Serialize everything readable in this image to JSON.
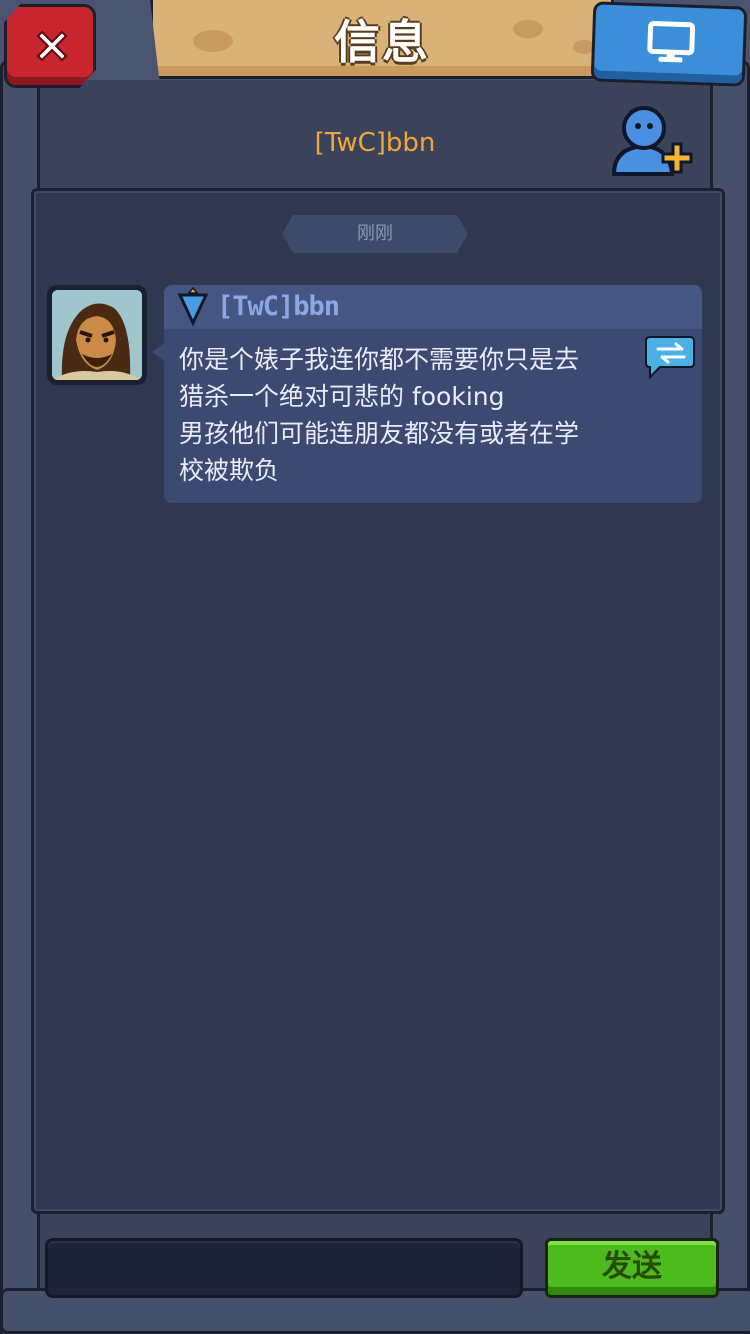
{
  "title": "信息",
  "header": {
    "username": "[TwC]bbn"
  },
  "timestamp": "刚刚",
  "message": {
    "sender": "[TwC]bbn",
    "lines": [
      "你是个婊子我连你都不需要你只是去",
      "猎杀一个绝对可悲的 fooking",
      "男孩他们可能连朋友都没有或者在学",
      "校被欺负"
    ]
  },
  "input": {
    "placeholder": ""
  },
  "send_label": "发送",
  "icons": {
    "close": "close-icon",
    "screen": "monitor-icon",
    "add_friend": "add-friend-icon",
    "rank": "rank-shield-icon",
    "translate": "translate-icon"
  },
  "colors": {
    "username": "#f2a53a",
    "send": "#4dbb1e",
    "close": "#c8262f",
    "screen": "#3a8fd8"
  }
}
